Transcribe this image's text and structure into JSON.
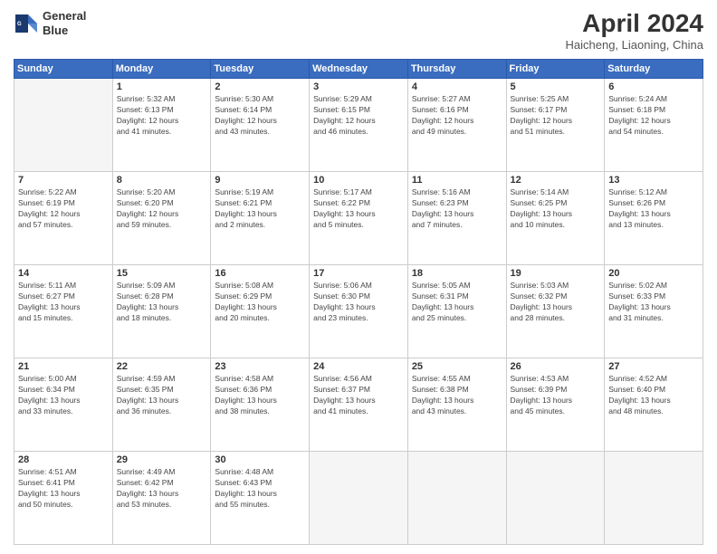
{
  "header": {
    "logo_line1": "General",
    "logo_line2": "Blue",
    "month": "April 2024",
    "location": "Haicheng, Liaoning, China"
  },
  "columns": [
    "Sunday",
    "Monday",
    "Tuesday",
    "Wednesday",
    "Thursday",
    "Friday",
    "Saturday"
  ],
  "weeks": [
    [
      {
        "day": "",
        "info": ""
      },
      {
        "day": "1",
        "info": "Sunrise: 5:32 AM\nSunset: 6:13 PM\nDaylight: 12 hours\nand 41 minutes."
      },
      {
        "day": "2",
        "info": "Sunrise: 5:30 AM\nSunset: 6:14 PM\nDaylight: 12 hours\nand 43 minutes."
      },
      {
        "day": "3",
        "info": "Sunrise: 5:29 AM\nSunset: 6:15 PM\nDaylight: 12 hours\nand 46 minutes."
      },
      {
        "day": "4",
        "info": "Sunrise: 5:27 AM\nSunset: 6:16 PM\nDaylight: 12 hours\nand 49 minutes."
      },
      {
        "day": "5",
        "info": "Sunrise: 5:25 AM\nSunset: 6:17 PM\nDaylight: 12 hours\nand 51 minutes."
      },
      {
        "day": "6",
        "info": "Sunrise: 5:24 AM\nSunset: 6:18 PM\nDaylight: 12 hours\nand 54 minutes."
      }
    ],
    [
      {
        "day": "7",
        "info": "Sunrise: 5:22 AM\nSunset: 6:19 PM\nDaylight: 12 hours\nand 57 minutes."
      },
      {
        "day": "8",
        "info": "Sunrise: 5:20 AM\nSunset: 6:20 PM\nDaylight: 12 hours\nand 59 minutes."
      },
      {
        "day": "9",
        "info": "Sunrise: 5:19 AM\nSunset: 6:21 PM\nDaylight: 13 hours\nand 2 minutes."
      },
      {
        "day": "10",
        "info": "Sunrise: 5:17 AM\nSunset: 6:22 PM\nDaylight: 13 hours\nand 5 minutes."
      },
      {
        "day": "11",
        "info": "Sunrise: 5:16 AM\nSunset: 6:23 PM\nDaylight: 13 hours\nand 7 minutes."
      },
      {
        "day": "12",
        "info": "Sunrise: 5:14 AM\nSunset: 6:25 PM\nDaylight: 13 hours\nand 10 minutes."
      },
      {
        "day": "13",
        "info": "Sunrise: 5:12 AM\nSunset: 6:26 PM\nDaylight: 13 hours\nand 13 minutes."
      }
    ],
    [
      {
        "day": "14",
        "info": "Sunrise: 5:11 AM\nSunset: 6:27 PM\nDaylight: 13 hours\nand 15 minutes."
      },
      {
        "day": "15",
        "info": "Sunrise: 5:09 AM\nSunset: 6:28 PM\nDaylight: 13 hours\nand 18 minutes."
      },
      {
        "day": "16",
        "info": "Sunrise: 5:08 AM\nSunset: 6:29 PM\nDaylight: 13 hours\nand 20 minutes."
      },
      {
        "day": "17",
        "info": "Sunrise: 5:06 AM\nSunset: 6:30 PM\nDaylight: 13 hours\nand 23 minutes."
      },
      {
        "day": "18",
        "info": "Sunrise: 5:05 AM\nSunset: 6:31 PM\nDaylight: 13 hours\nand 25 minutes."
      },
      {
        "day": "19",
        "info": "Sunrise: 5:03 AM\nSunset: 6:32 PM\nDaylight: 13 hours\nand 28 minutes."
      },
      {
        "day": "20",
        "info": "Sunrise: 5:02 AM\nSunset: 6:33 PM\nDaylight: 13 hours\nand 31 minutes."
      }
    ],
    [
      {
        "day": "21",
        "info": "Sunrise: 5:00 AM\nSunset: 6:34 PM\nDaylight: 13 hours\nand 33 minutes."
      },
      {
        "day": "22",
        "info": "Sunrise: 4:59 AM\nSunset: 6:35 PM\nDaylight: 13 hours\nand 36 minutes."
      },
      {
        "day": "23",
        "info": "Sunrise: 4:58 AM\nSunset: 6:36 PM\nDaylight: 13 hours\nand 38 minutes."
      },
      {
        "day": "24",
        "info": "Sunrise: 4:56 AM\nSunset: 6:37 PM\nDaylight: 13 hours\nand 41 minutes."
      },
      {
        "day": "25",
        "info": "Sunrise: 4:55 AM\nSunset: 6:38 PM\nDaylight: 13 hours\nand 43 minutes."
      },
      {
        "day": "26",
        "info": "Sunrise: 4:53 AM\nSunset: 6:39 PM\nDaylight: 13 hours\nand 45 minutes."
      },
      {
        "day": "27",
        "info": "Sunrise: 4:52 AM\nSunset: 6:40 PM\nDaylight: 13 hours\nand 48 minutes."
      }
    ],
    [
      {
        "day": "28",
        "info": "Sunrise: 4:51 AM\nSunset: 6:41 PM\nDaylight: 13 hours\nand 50 minutes."
      },
      {
        "day": "29",
        "info": "Sunrise: 4:49 AM\nSunset: 6:42 PM\nDaylight: 13 hours\nand 53 minutes."
      },
      {
        "day": "30",
        "info": "Sunrise: 4:48 AM\nSunset: 6:43 PM\nDaylight: 13 hours\nand 55 minutes."
      },
      {
        "day": "",
        "info": ""
      },
      {
        "day": "",
        "info": ""
      },
      {
        "day": "",
        "info": ""
      },
      {
        "day": "",
        "info": ""
      }
    ]
  ]
}
